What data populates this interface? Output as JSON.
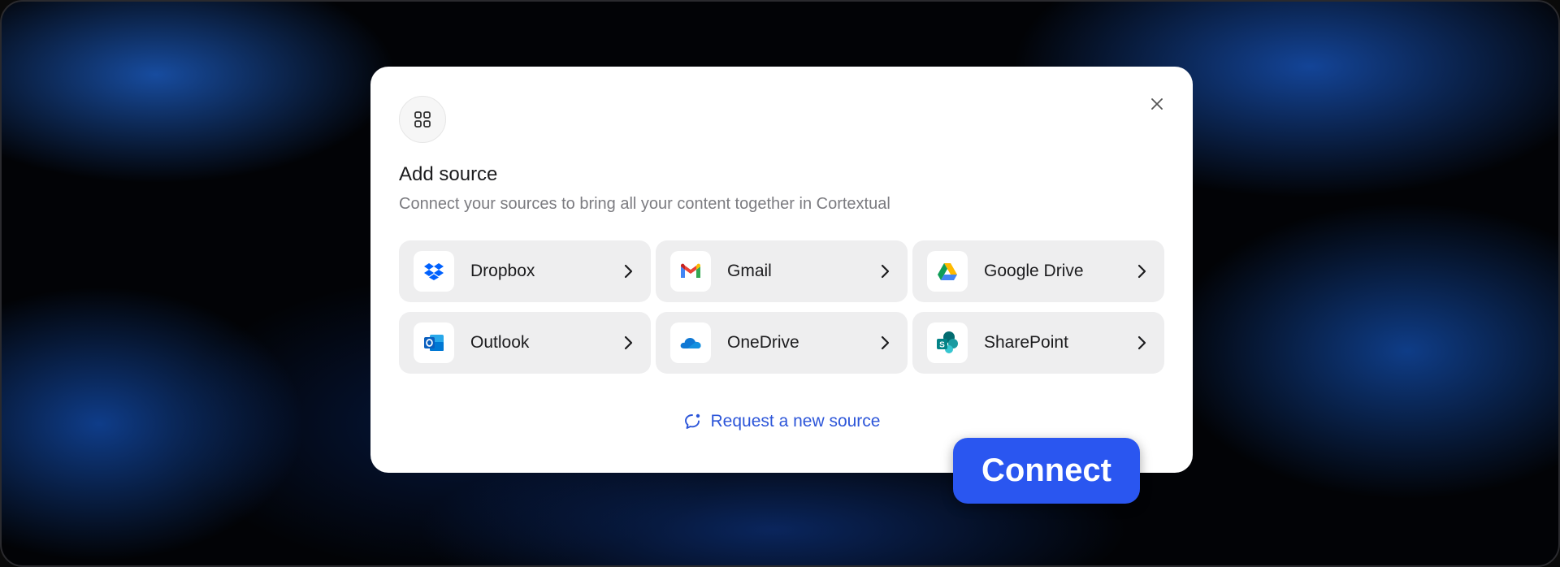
{
  "modal": {
    "title": "Add source",
    "subtitle": "Connect your sources to bring all your content together in Cortextual",
    "header_icon": "grid-apps-icon",
    "close_icon": "close-icon",
    "sources": [
      {
        "label": "Dropbox",
        "icon": "dropbox-icon"
      },
      {
        "label": "Gmail",
        "icon": "gmail-icon"
      },
      {
        "label": "Google Drive",
        "icon": "google-drive-icon"
      },
      {
        "label": "Outlook",
        "icon": "outlook-icon"
      },
      {
        "label": "OneDrive",
        "icon": "onedrive-icon"
      },
      {
        "label": "SharePoint",
        "icon": "sharepoint-icon"
      }
    ],
    "request_label": "Request a new source",
    "request_icon": "chat-bubble-icon"
  },
  "connect_label": "Connect",
  "colors": {
    "accent": "#2a56f0",
    "link": "#2d56d9",
    "card_bg": "#eeeeef",
    "modal_bg": "#ffffff"
  }
}
